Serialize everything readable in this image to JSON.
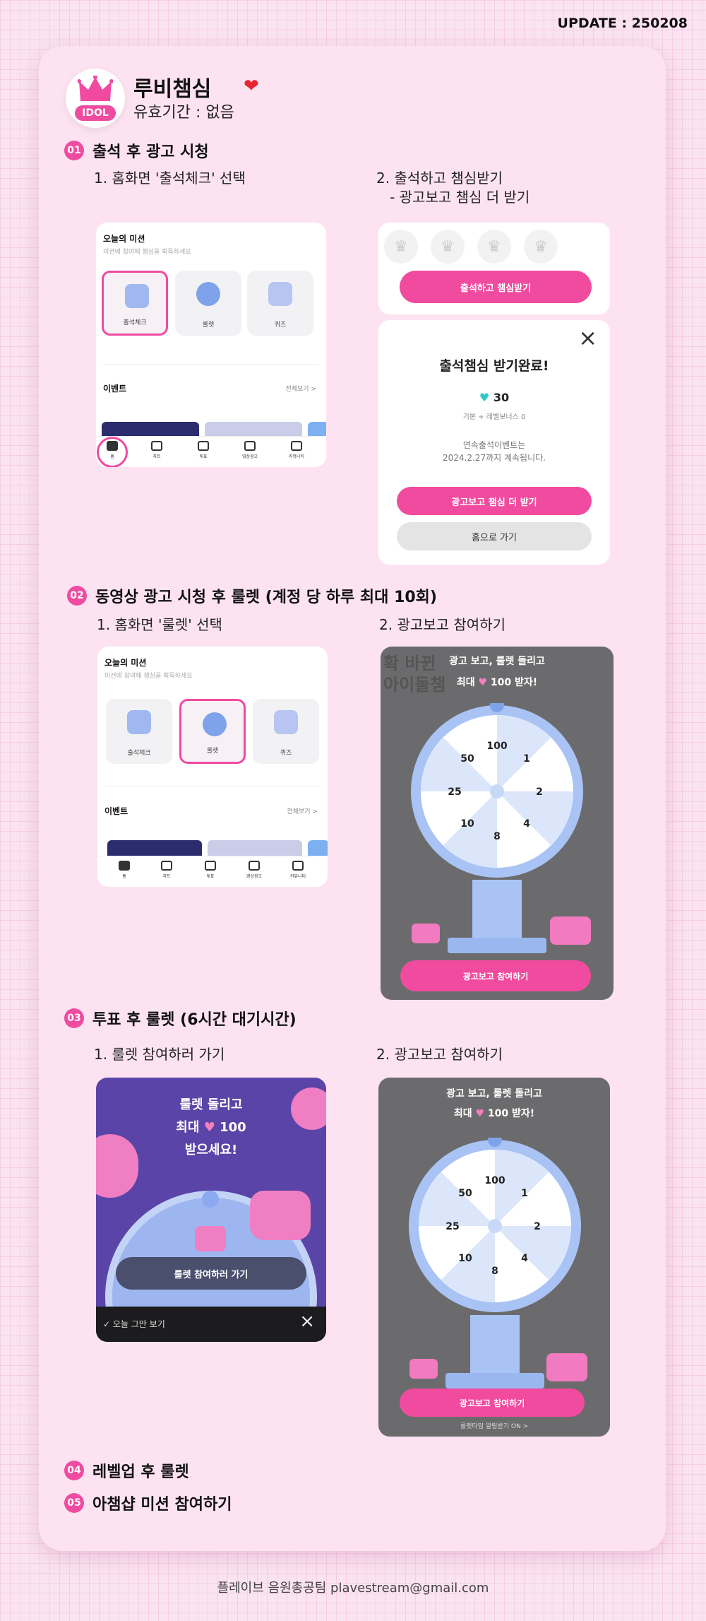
{
  "update": "UPDATE : 250208",
  "header": {
    "logo_text": "IDOL",
    "title": "루비챔심",
    "heart": "❤",
    "validity": "유효기간 : 없음"
  },
  "sections": [
    {
      "num": "01",
      "title": "출석 후 광고 시청"
    },
    {
      "num": "02",
      "title": "동영상 광고 시청 후 룰렛 (계정 당 하루 최대 10회)"
    },
    {
      "num": "03",
      "title": "투표 후 룰렛 (6시간 대기시간)"
    },
    {
      "num": "04",
      "title": "레벨업 후 룰렛"
    },
    {
      "num": "05",
      "title": "아챔샵 미션 참여하기"
    }
  ],
  "s1": {
    "step1": "1. 홈화면 '출석체크' 선택",
    "step2": "2. 출석하고 챔심받기\n   - 광고보고 챔심 더 받기",
    "mission_title": "오늘의 미션",
    "mission_sub": "미션에 참여해 챔심을 획득하세요",
    "tiles": [
      "출석체크",
      "룰렛",
      "퀴즈"
    ],
    "event_title": "이벤트",
    "event_more": "전체보기 >",
    "tabs": [
      "홈",
      "차트",
      "투표",
      "영상광고",
      "커뮤니티"
    ],
    "attend_btn": "출석하고 챔심받기",
    "popup_title": "출석챔심 받기완료!",
    "popup_amount": "30",
    "popup_detail": "기본 + 레벨보너스 0",
    "popup_notice1": "연속출석이벤트는",
    "popup_notice2": "2024.2.27까지 계속됩니다.",
    "ad_btn": "광고보고 챔심 더 받기",
    "home_btn": "홈으로 가기",
    "close": "×"
  },
  "s2": {
    "step1": "1. 홈화면 '룰렛' 선택",
    "step2": "2. 광고보고 참여하기",
    "mission_title": "오늘의 미션",
    "mission_sub": "미션에 참여해 챔심을 획득하세요",
    "tiles": [
      "출석체크",
      "룰렛",
      "퀴즈"
    ],
    "event_title": "이벤트",
    "event_more": "전체보기 >",
    "tabs": [
      "홈",
      "차트",
      "투표",
      "영상광고",
      "커뮤니티"
    ],
    "roulette_line1": "광고 보고, 룰렛 돌리고",
    "roulette_line2a": "최대",
    "roulette_line2b": "100 받자!",
    "bg_text1": "확 바뀐",
    "bg_text2": "아이돌챔",
    "wheel": [
      "100",
      "1",
      "2",
      "4",
      "8",
      "10",
      "25",
      "50"
    ],
    "join_btn": "광고보고 참여하기"
  },
  "s3": {
    "step1": "1. 룰렛 참여하러 가기",
    "step2": "2. 광고보고 참여하기",
    "promo_line1": "룰렛 돌리고",
    "promo_line2a": "최대",
    "promo_line2b": "100",
    "promo_line3": "받으세요!",
    "go_btn": "룰렛 참여하러 가기",
    "dismiss": "오늘 그만 보기",
    "close": "×",
    "roulette_line1": "광고 보고, 룰렛 돌리고",
    "roulette_line2a": "최대",
    "roulette_line2b": "100 받자!",
    "wheel": [
      "100",
      "1",
      "2",
      "4",
      "8",
      "10",
      "25",
      "50"
    ],
    "join_btn": "광고보고 참여하기",
    "alarm": "룰렛타임 알림받기 ON >"
  },
  "footer": "플레이브 음원총공팀 plavestream@gmail.com",
  "colors": {
    "accent": "#f04aa1",
    "card": "#fde3f1",
    "wheel": "#a9c3f5"
  }
}
